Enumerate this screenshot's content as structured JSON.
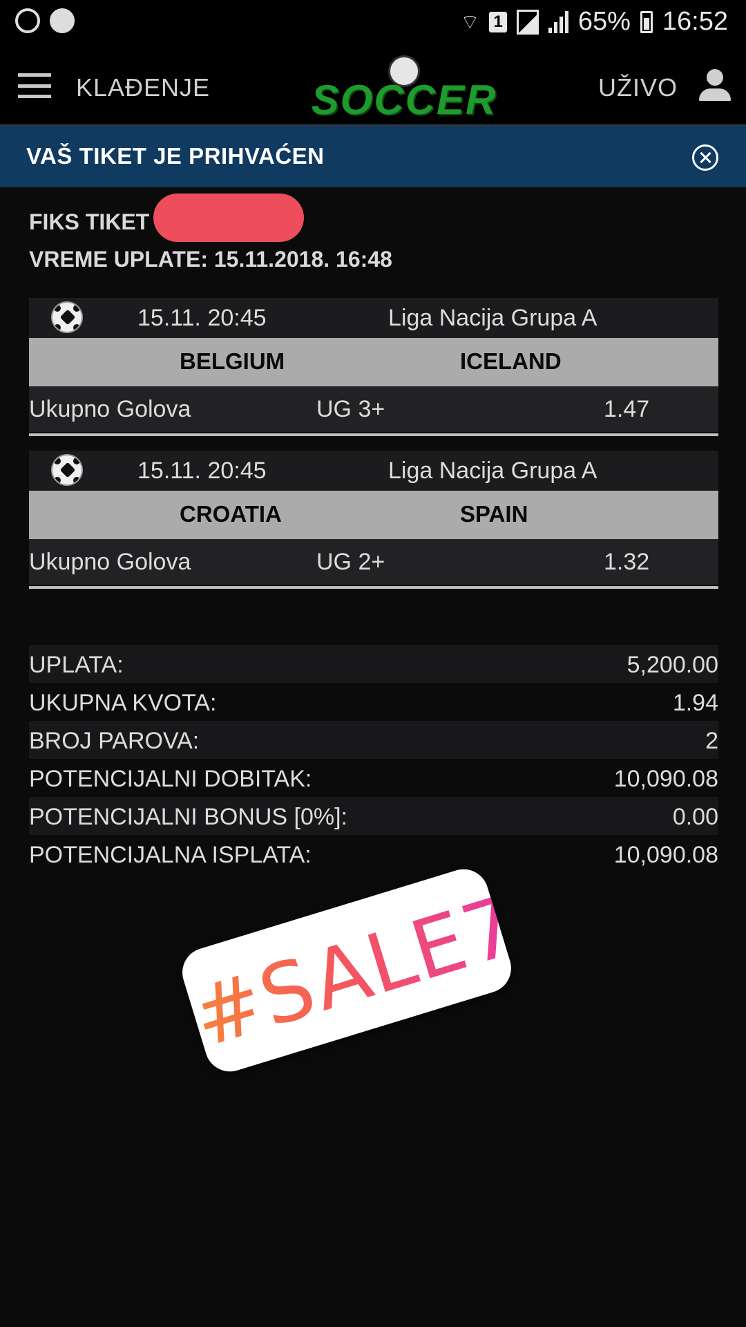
{
  "status_bar": {
    "notification_icons": [
      "whatsapp-icon",
      "phone-call-icon"
    ],
    "sim_badge": "1",
    "battery": "65%",
    "time": "16:52"
  },
  "nav": {
    "betting_label": "KLAĐENJE",
    "logo_text": "SOCCER",
    "live_label": "UŽIVO"
  },
  "banner": {
    "message": "VAŠ TIKET JE PRIHVAĆEN"
  },
  "ticket": {
    "title": "FIKS TIKET",
    "payment_time_label": "VREME UPLATE:",
    "payment_time_value": "15.11.2018. 16:48"
  },
  "matches": [
    {
      "datetime": "15.11. 20:45",
      "league": "Liga Nacija Grupa A",
      "home": "BELGIUM",
      "away": "ICELAND",
      "market": "Ukupno Golova",
      "pick": "UG 3+",
      "odds": "1.47"
    },
    {
      "datetime": "15.11. 20:45",
      "league": "Liga Nacija Grupa A",
      "home": "CROATIA",
      "away": "SPAIN",
      "market": "Ukupno Golova",
      "pick": "UG 2+",
      "odds": "1.32"
    }
  ],
  "summary": [
    {
      "label": "UPLATA:",
      "value": "5,200.00"
    },
    {
      "label": "UKUPNA KVOTA:",
      "value": "1.94"
    },
    {
      "label": "BROJ PAROVA:",
      "value": "2"
    },
    {
      "label": "POTENCIJALNI DOBITAK:",
      "value": "10,090.08"
    },
    {
      "label": "POTENCIJALNI BONUS [0%]:",
      "value": "0.00"
    },
    {
      "label": "POTENCIJALNA ISPLATA:",
      "value": "10,090.08"
    }
  ],
  "sticker": {
    "text": "#SALE7",
    "gradient": [
      "#f7813b",
      "#f4565f",
      "#ea3d9a"
    ]
  },
  "colors": {
    "background": "#0b0b0b",
    "banner": "#103a5f",
    "teams_bar": "#ababab",
    "logo_green": "#1f9a2c",
    "redaction": "#ee4d5b"
  }
}
